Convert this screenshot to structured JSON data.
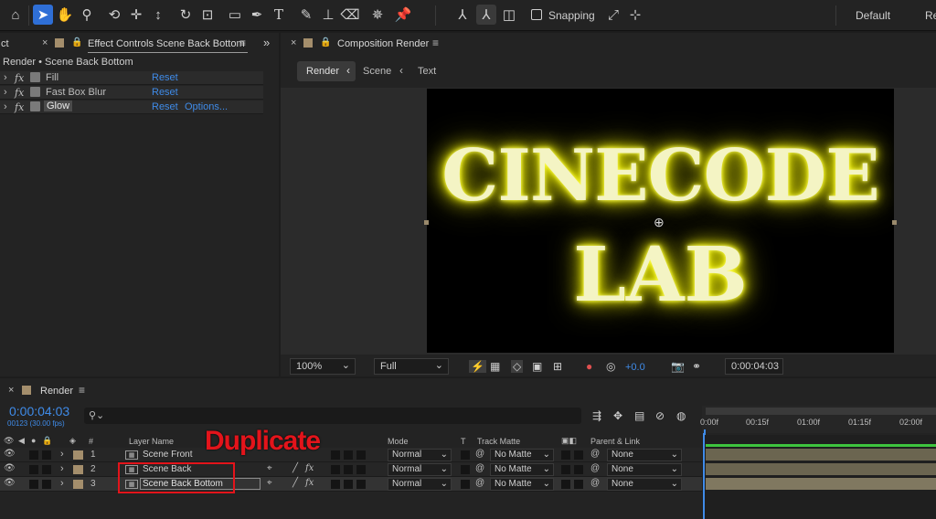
{
  "toolbar": {
    "snapping_label": "Snapping",
    "workspace_default": "Default",
    "workspace_next": "Re"
  },
  "effect_panel": {
    "tab_left_partial": "ct",
    "tab_title": "Effect Controls Scene Back Bottom",
    "breadcrumb": "Render • Scene Back Bottom",
    "effects": [
      {
        "name": "Fill",
        "reset": "Reset",
        "options": ""
      },
      {
        "name": "Fast Box Blur",
        "reset": "Reset",
        "options": ""
      },
      {
        "name": "Glow",
        "reset": "Reset",
        "options": "Options..."
      }
    ]
  },
  "comp_panel": {
    "tab_title": "Composition Render",
    "breadcrumbs": [
      "Render",
      "Scene",
      "Text"
    ],
    "canvas_text_line1": "CINECODE",
    "canvas_text_line2": "LAB",
    "zoom": "100%",
    "resolution": "Full",
    "exposure": "+0.0",
    "timecode": "0:00:04:03"
  },
  "timeline": {
    "tab_title": "Render",
    "timecode": "0:00:04:03",
    "frame_info": "00123 (30.00 fps)",
    "search_placeholder": "",
    "headers": {
      "num": "#",
      "layer_name": "Layer Name",
      "mode": "Mode",
      "t": "T",
      "track_matte": "Track Matte",
      "parent": "Parent & Link"
    },
    "ruler": [
      "0:00f",
      "00:15f",
      "01:00f",
      "01:15f",
      "02:00f"
    ],
    "annotation": "Duplicate",
    "layers": [
      {
        "num": "1",
        "name": "Scene Front",
        "mode": "Normal",
        "matte": "No Matte",
        "parent": "None"
      },
      {
        "num": "2",
        "name": "Scene Back",
        "mode": "Normal",
        "matte": "No Matte",
        "parent": "None"
      },
      {
        "num": "3",
        "name": "Scene Back Bottom",
        "mode": "Normal",
        "matte": "No Matte",
        "parent": "None"
      }
    ],
    "colors": {
      "accent_blue": "#3f8be8",
      "annotation_red": "#e3141b",
      "bar_green": "#3ec43e"
    }
  }
}
